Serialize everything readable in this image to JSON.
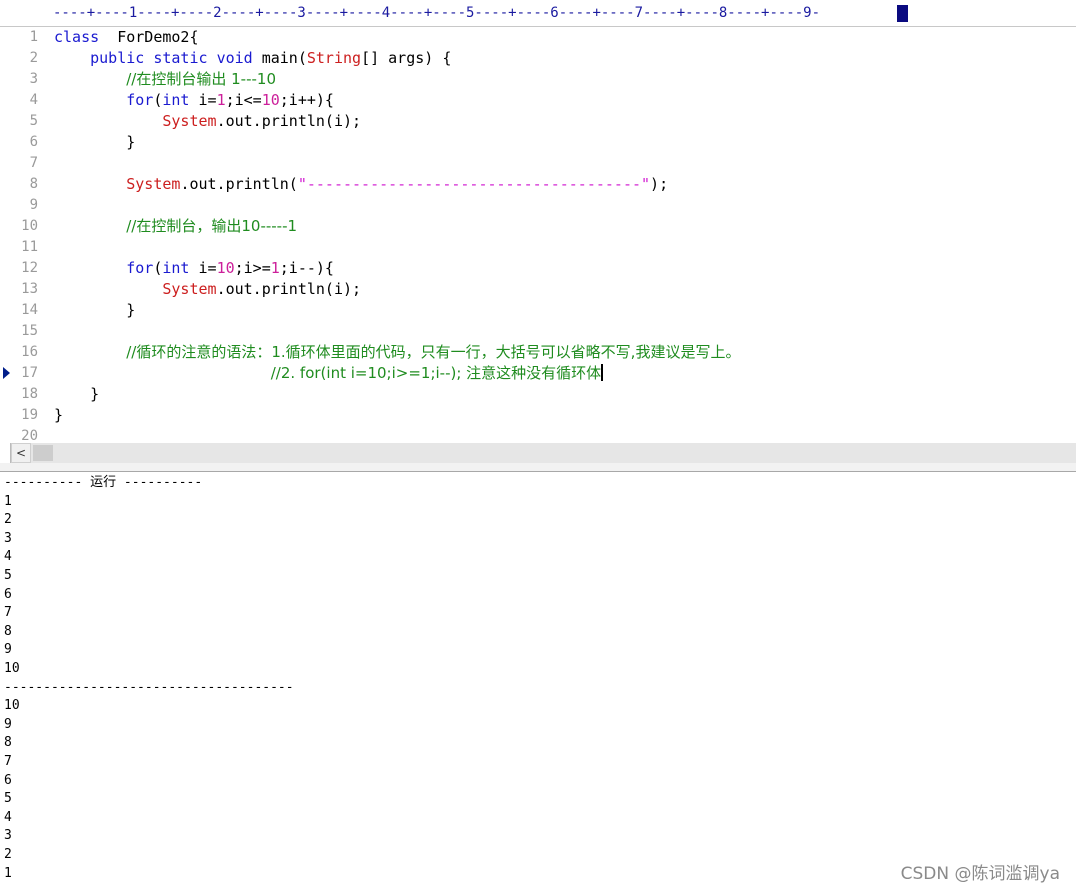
{
  "ruler": {
    "text": "----+----1----+----2----+----3----+----4----+----5----+----6----+----7----+----8----+----9-"
  },
  "editor": {
    "lines": [
      {
        "n": "1",
        "segments": [
          [
            "kw",
            "class"
          ],
          [
            "",
            "  ForDemo2{"
          ]
        ]
      },
      {
        "n": "2",
        "segments": [
          [
            "",
            "    "
          ],
          [
            "kw",
            "public"
          ],
          [
            "",
            " "
          ],
          [
            "kw",
            "static"
          ],
          [
            "",
            " "
          ],
          [
            "kw",
            "void"
          ],
          [
            "",
            " main("
          ],
          [
            "sys",
            "String"
          ],
          [
            "",
            "[] args) {"
          ]
        ]
      },
      {
        "n": "3",
        "segments": [
          [
            "",
            "        "
          ],
          [
            "cmt",
            "//在控制台输出 1---10"
          ]
        ]
      },
      {
        "n": "4",
        "segments": [
          [
            "",
            "        "
          ],
          [
            "kw",
            "for"
          ],
          [
            "",
            "("
          ],
          [
            "kw",
            "int"
          ],
          [
            "",
            " i="
          ],
          [
            "num",
            "1"
          ],
          [
            "",
            ";i<="
          ],
          [
            "num",
            "10"
          ],
          [
            "",
            ";i++){"
          ]
        ]
      },
      {
        "n": "5",
        "segments": [
          [
            "",
            "            "
          ],
          [
            "sys",
            "System"
          ],
          [
            "",
            ".out.println(i);"
          ]
        ]
      },
      {
        "n": "6",
        "segments": [
          [
            "",
            "        }"
          ]
        ]
      },
      {
        "n": "7",
        "segments": []
      },
      {
        "n": "8",
        "segments": [
          [
            "",
            "        "
          ],
          [
            "sys",
            "System"
          ],
          [
            "",
            ".out.println("
          ],
          [
            "str",
            "\"-------------------------------------\""
          ],
          [
            "",
            ");"
          ]
        ]
      },
      {
        "n": "9",
        "segments": []
      },
      {
        "n": "10",
        "segments": [
          [
            "",
            "        "
          ],
          [
            "cmt",
            "//在控制台，输出10-----1"
          ]
        ]
      },
      {
        "n": "11",
        "segments": []
      },
      {
        "n": "12",
        "segments": [
          [
            "",
            "        "
          ],
          [
            "kw",
            "for"
          ],
          [
            "",
            "("
          ],
          [
            "kw",
            "int"
          ],
          [
            "",
            " i="
          ],
          [
            "num",
            "10"
          ],
          [
            "",
            ";i>="
          ],
          [
            "num",
            "1"
          ],
          [
            "",
            ";i--){"
          ]
        ]
      },
      {
        "n": "13",
        "segments": [
          [
            "",
            "            "
          ],
          [
            "sys",
            "System"
          ],
          [
            "",
            ".out.println(i);"
          ]
        ]
      },
      {
        "n": "14",
        "segments": [
          [
            "",
            "        }"
          ]
        ]
      },
      {
        "n": "15",
        "segments": []
      },
      {
        "n": "16",
        "segments": [
          [
            "",
            "        "
          ],
          [
            "cmt",
            "//循环的注意的语法：1.循环体里面的代码，只有一行，大括号可以省略不写,我建议是写上。"
          ]
        ]
      },
      {
        "n": "17",
        "segments": [
          [
            "",
            "                        "
          ],
          [
            "cmt",
            "//2. for(int i=10;i>=1;i--); 注意这种没有循环体"
          ]
        ]
      },
      {
        "n": "18",
        "segments": [
          [
            "",
            "    }"
          ]
        ]
      },
      {
        "n": "19",
        "segments": [
          [
            "",
            "}"
          ]
        ]
      },
      {
        "n": "20",
        "segments": []
      }
    ]
  },
  "scrollbar": {
    "left_arrow": "<"
  },
  "output": {
    "lines": [
      "---------- 运行 ----------",
      "1",
      "2",
      "3",
      "4",
      "5",
      "6",
      "7",
      "8",
      "9",
      "10",
      "-------------------------------------",
      "10",
      "9",
      "8",
      "7",
      "6",
      "5",
      "4",
      "3",
      "2",
      "1"
    ]
  },
  "watermark": "CSDN @陈词滥调ya",
  "colors": {
    "keyword": "#1a1ad0",
    "system_class": "#cc1f1f",
    "number_literal": "#cc1f9a",
    "string_literal": "#d21fd2",
    "comment": "#1f8c1f",
    "line_number": "#9a9a9a",
    "ruler_text": "#1a1aa0"
  }
}
